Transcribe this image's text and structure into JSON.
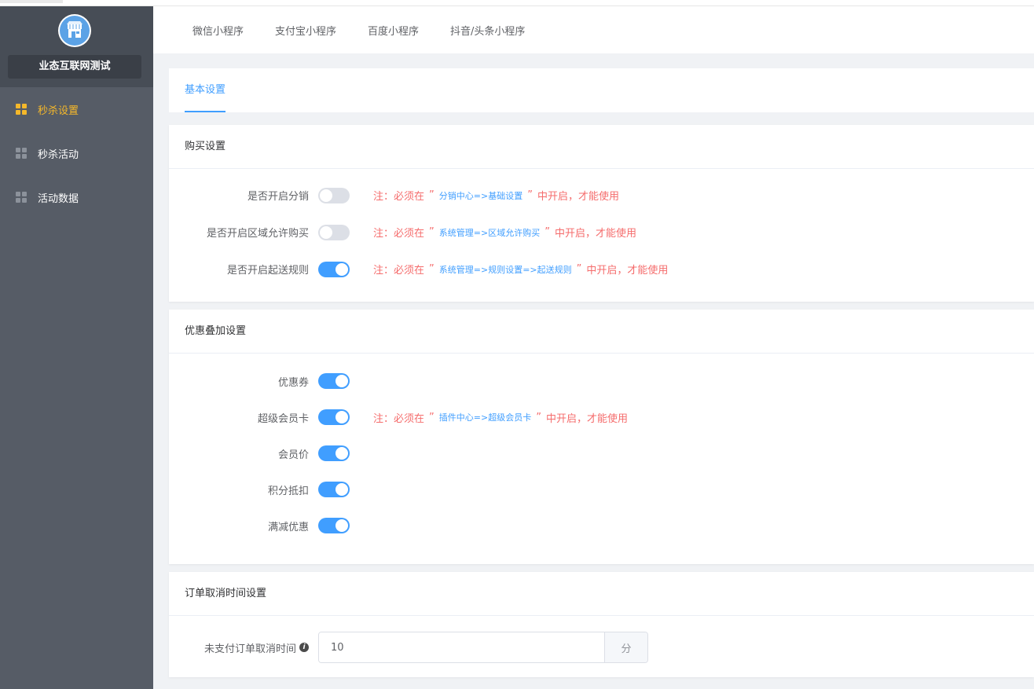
{
  "sidebar": {
    "shop_name": "业态互联网测试",
    "items": [
      {
        "label": "秒杀设置",
        "icon": "grid-icon",
        "active": true
      },
      {
        "label": "秒杀活动",
        "icon": "grid-icon",
        "active": false
      },
      {
        "label": "活动数据",
        "icon": "grid-icon",
        "active": false
      }
    ]
  },
  "platform_tabs": [
    "微信小程序",
    "支付宝小程序",
    "百度小程序",
    "抖音/头条小程序"
  ],
  "settings_tab": "基本设置",
  "purchase": {
    "title": "购买设置",
    "rows": [
      {
        "label": "是否开启分销",
        "on": false,
        "note_prefix": "注：必须在",
        "note_path": "分销中心=>基础设置",
        "note_suffix": "中开启，才能使用"
      },
      {
        "label": "是否开启区域允许购买",
        "on": false,
        "note_prefix": "注：必须在",
        "note_path": "系统管理=>区域允许购买",
        "note_suffix": "中开启，才能使用"
      },
      {
        "label": "是否开启起送规则",
        "on": true,
        "note_prefix": "注：必须在",
        "note_path": "系统管理=>规则设置=>起送规则",
        "note_suffix": "中开启，才能使用"
      }
    ]
  },
  "discount": {
    "title": "优惠叠加设置",
    "rows": [
      {
        "label": "优惠券",
        "on": true
      },
      {
        "label": "超级会员卡",
        "on": true,
        "note_prefix": "注：必须在",
        "note_path": "插件中心=>超级会员卡",
        "note_suffix": "中开启，才能使用"
      },
      {
        "label": "会员价",
        "on": true
      },
      {
        "label": "积分抵扣",
        "on": true
      },
      {
        "label": "满减优惠",
        "on": true
      }
    ]
  },
  "order_cancel": {
    "title": "订单取消时间设置",
    "label": "未支付订单取消时间",
    "value": "10",
    "unit": "分"
  },
  "quote_mark": "”",
  "colors": {
    "accent": "#409eff",
    "active_menu": "#f5b82a",
    "warning": "#f56c6c",
    "sidebar_bg": "#565c66"
  }
}
